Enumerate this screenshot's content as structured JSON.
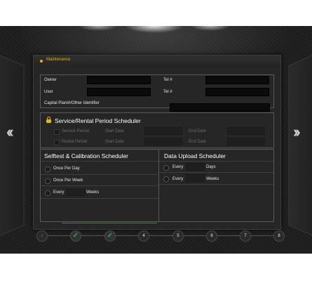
{
  "header": {
    "title": "Maintenance"
  },
  "owner": {
    "label": "Owner",
    "value": "",
    "tel_label": "Tel #",
    "tel_value": ""
  },
  "user": {
    "label": "User",
    "value": "",
    "tel_label": "Tel #",
    "tel_value": ""
  },
  "capital": {
    "label": "Capital Plant#/Other Identifier",
    "value": ""
  },
  "service_scheduler": {
    "title": "Service/Rental Period Scheduler",
    "rows": [
      {
        "check_label": "Service Period",
        "start_label": "Start Date",
        "end_label": "End Date"
      },
      {
        "check_label": "Rental Period",
        "start_label": "Start Date",
        "end_label": "End Date"
      }
    ]
  },
  "selftest": {
    "title": "Selftest & Calibration Scheduler",
    "options": [
      "Once Per Day",
      "Once Per Week",
      "Every"
    ],
    "every_unit": "Weeks"
  },
  "upload": {
    "title": "Data Upload Scheduler",
    "options": [
      {
        "label": "Every",
        "unit": "Days"
      },
      {
        "label": "Every",
        "unit": "Weeks"
      }
    ]
  },
  "steps": [
    "1",
    "",
    "",
    "4",
    "5",
    "6",
    "7",
    "8"
  ],
  "colors": {
    "accent": "#e8b400",
    "check": "#2ea84a",
    "background": "#1e1e1e"
  }
}
